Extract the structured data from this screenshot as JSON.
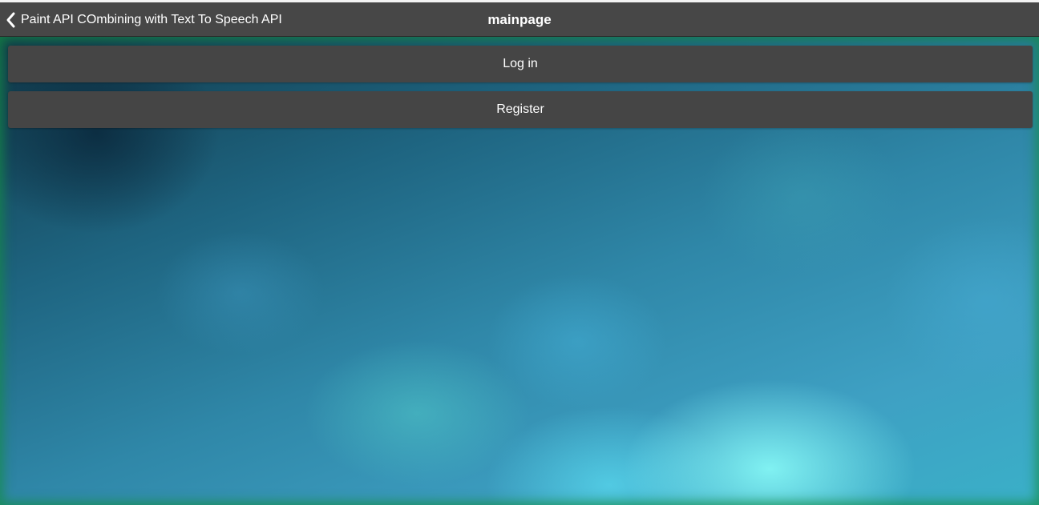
{
  "header": {
    "back_label": "Paint API COmbining with Text To Speech API",
    "back_icon": "chevron-left-icon",
    "title": "mainpage"
  },
  "actions": {
    "login_label": "Log in",
    "register_label": "Register"
  },
  "colors": {
    "header_bg": "#474747",
    "button_bg": "#454545",
    "text": "#ffffff"
  }
}
